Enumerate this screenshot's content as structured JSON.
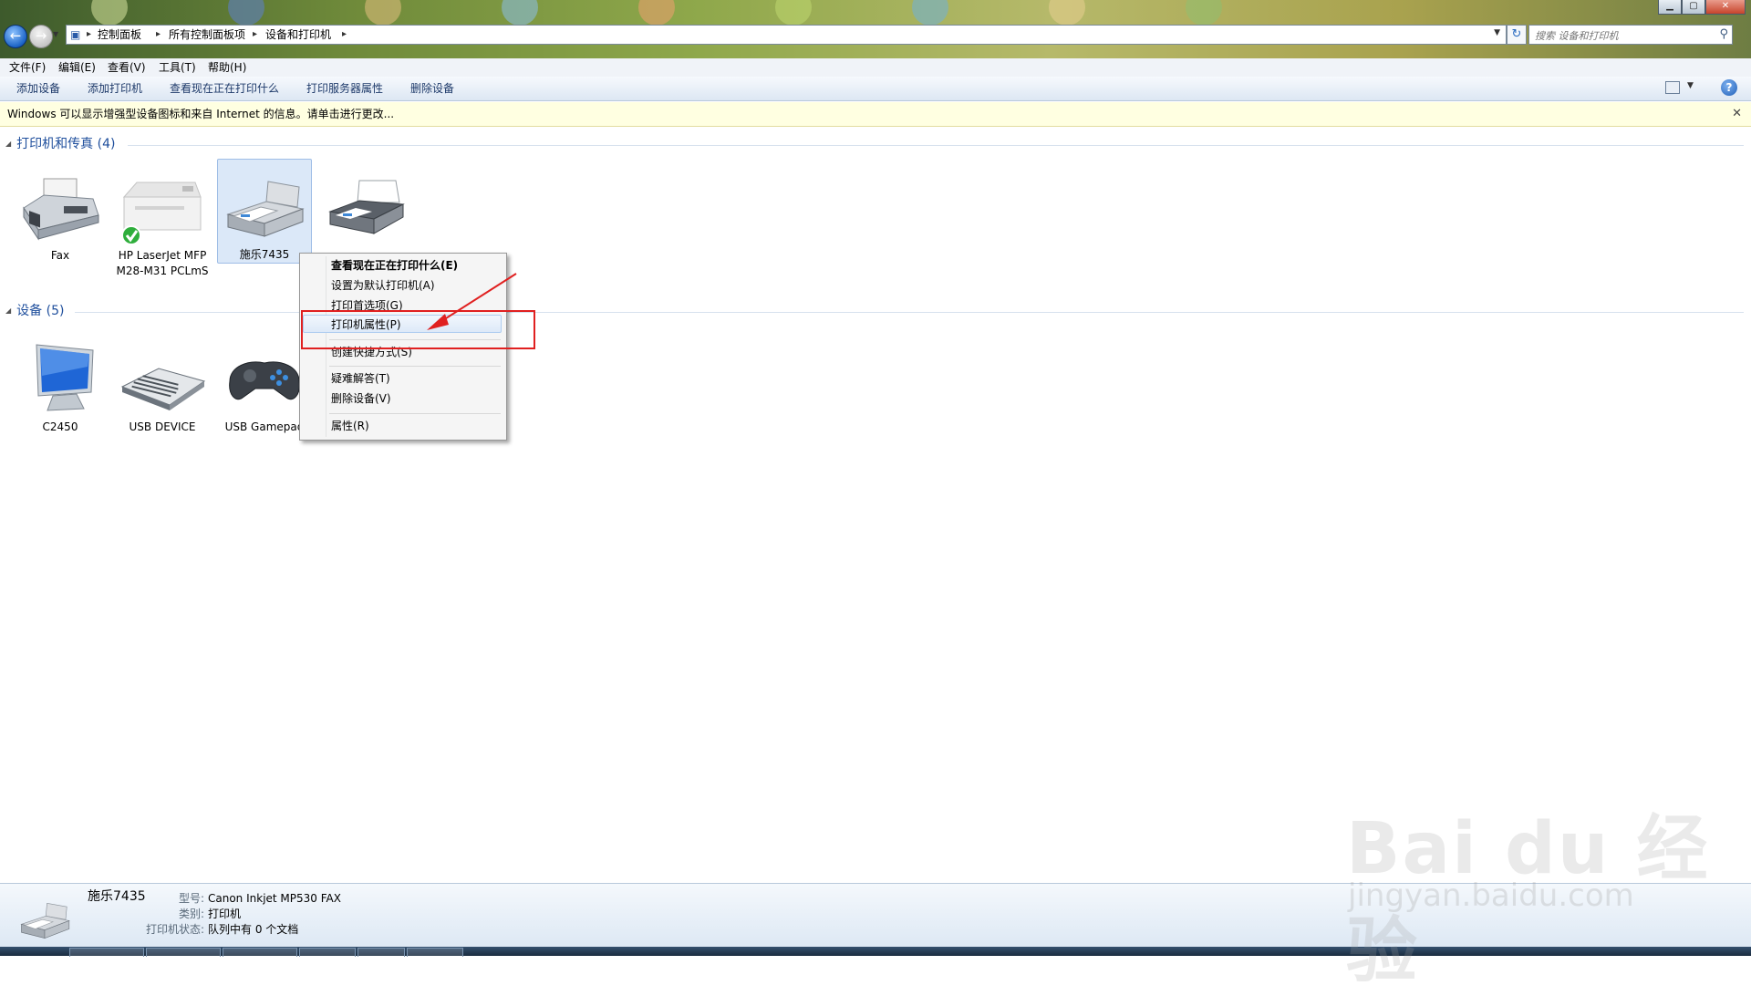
{
  "address_bar": {
    "breadcrumbs": [
      "控制面板",
      "所有控制面板项",
      "设备和打印机"
    ],
    "search_placeholder": "搜索 设备和打印机"
  },
  "menu": [
    "文件(F)",
    "编辑(E)",
    "查看(V)",
    "工具(T)",
    "帮助(H)"
  ],
  "commands": [
    "添加设备",
    "添加打印机",
    "查看现在正在打印什么",
    "打印服务器属性",
    "删除设备"
  ],
  "info_bar": "Windows 可以显示增强型设备图标和来自 Internet 的信息。请单击进行更改...",
  "groups": {
    "printers": {
      "title": "打印机和传真 (4)",
      "items": [
        {
          "label": "Fax",
          "icon": "fax-icon"
        },
        {
          "label": "HP LaserJet MFP M28-M31 PCLmS",
          "icon": "laser-printer-icon",
          "default": true
        },
        {
          "label": "施乐7435",
          "icon": "printer-icon",
          "selected": true
        },
        {
          "label": "",
          "icon": "printer-icon"
        }
      ]
    },
    "devices": {
      "title": "设备 (5)",
      "items": [
        {
          "label": "C2450",
          "icon": "monitor-icon"
        },
        {
          "label": "USB DEVICE",
          "icon": "keyboard-icon"
        },
        {
          "label": "USB Gamepad",
          "icon": "gamepad-icon"
        }
      ]
    }
  },
  "context_menu": {
    "items": [
      {
        "label": "查看现在正在打印什么(E)",
        "bold": true
      },
      {
        "label": "设置为默认打印机(A)"
      },
      {
        "label": "打印首选项(G)"
      },
      {
        "label": "打印机属性(P)",
        "highlighted": true
      },
      {
        "label": "创建快捷方式(S)"
      },
      {
        "label": "疑难解答(T)"
      },
      {
        "label": "删除设备(V)"
      },
      {
        "label": "属性(R)"
      }
    ]
  },
  "annotation_color": "#e02020",
  "details": {
    "name": "施乐7435",
    "model_label": "型号:",
    "model_value": "Canon Inkjet MP530 FAX",
    "category_label": "类别:",
    "category_value": "打印机",
    "status_label": "打印机状态:",
    "status_value": "队列中有 0 个文档"
  },
  "watermark": {
    "logo": "Bai du 经验",
    "url": "jingyan.baidu.com"
  }
}
